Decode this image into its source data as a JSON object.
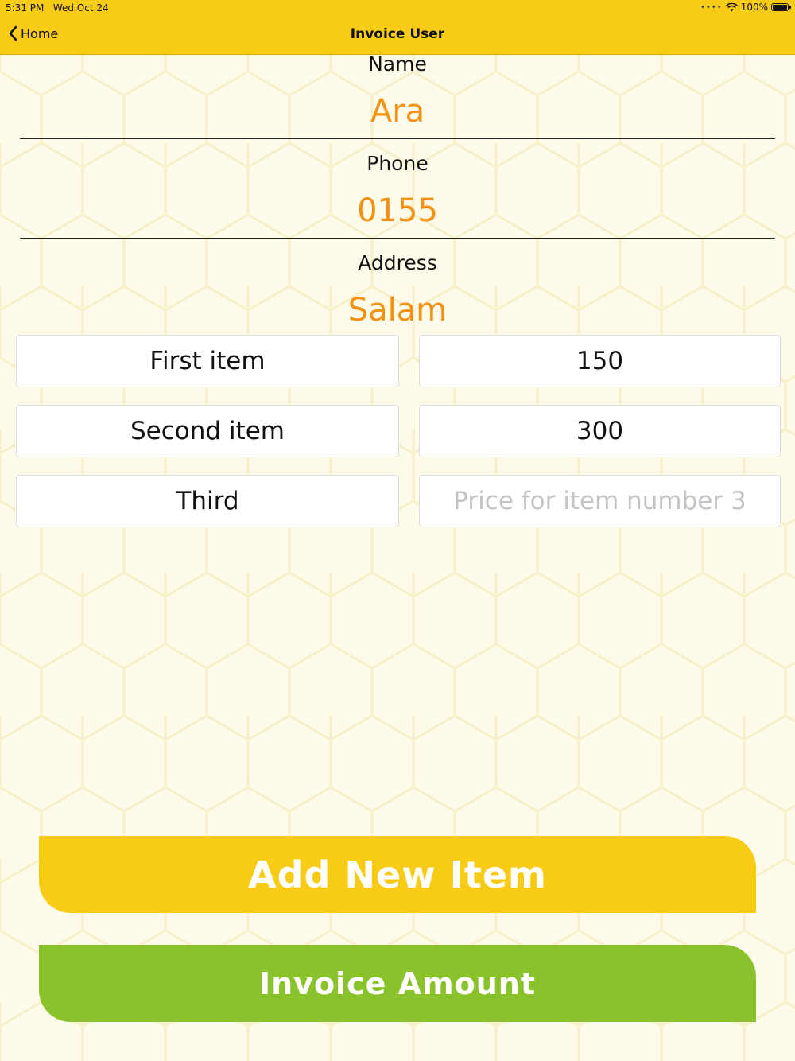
{
  "status_bar": {
    "time": "5:31 PM",
    "date": "Wed Oct 24",
    "battery": "100%",
    "signal_dots": "••••",
    "battery_level": 1.0
  },
  "nav": {
    "back_label": "Home",
    "title": "Invoice User"
  },
  "form": {
    "name_label": "Name",
    "name_value": "Ara",
    "phone_label": "Phone",
    "phone_value": "0155",
    "address_label": "Address",
    "address_value": "Salam"
  },
  "items": [
    {
      "name": "First item",
      "price": "150"
    },
    {
      "name": "Second item",
      "price": "300"
    },
    {
      "name": "Third",
      "price": "",
      "price_placeholder": "Price for item number 3"
    }
  ],
  "buttons": {
    "add_item": "Add New Item",
    "invoice_amount": "Invoice Amount"
  },
  "colors": {
    "bar": "#f8cb16",
    "value_text": "#f39212",
    "add_button": "#f8cb16",
    "invoice_button": "#8ac22c"
  },
  "icons": {
    "back": "chevron-left-icon",
    "wifi": "wifi-icon",
    "battery": "battery-icon"
  }
}
